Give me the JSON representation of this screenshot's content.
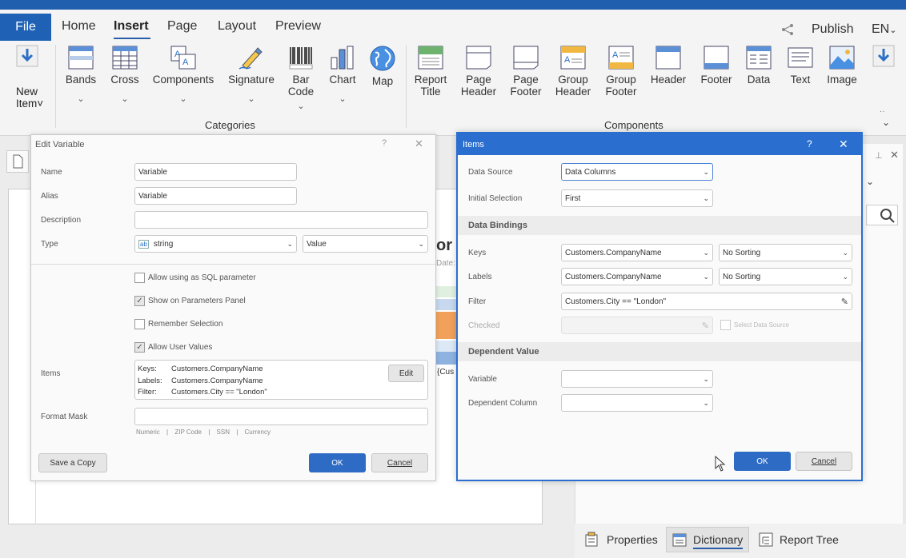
{
  "menu": {
    "file": "File",
    "tabs": [
      "Home",
      "Insert",
      "Page",
      "Layout",
      "Preview"
    ],
    "publish": "Publish",
    "language": "EN"
  },
  "ribbon": {
    "new_item": [
      "New",
      "Item"
    ],
    "categories": [
      {
        "label": "Bands"
      },
      {
        "label": "Cross"
      },
      {
        "label": "Components"
      },
      {
        "label": "Signature"
      },
      {
        "label": "Bar",
        "label2": "Code"
      },
      {
        "label": "Chart"
      },
      {
        "label": "Map"
      }
    ],
    "categories_label": "Categories",
    "components": [
      {
        "label": "Report",
        "label2": "Title"
      },
      {
        "label": "Page",
        "label2": "Header"
      },
      {
        "label": "Page",
        "label2": "Footer"
      },
      {
        "label": "Group",
        "label2": "Header"
      },
      {
        "label": "Group",
        "label2": "Footer"
      },
      {
        "label": "Header"
      },
      {
        "label": "Footer"
      },
      {
        "label": "Data"
      },
      {
        "label": "Text"
      },
      {
        "label": "Image"
      }
    ],
    "components_label": "Components"
  },
  "bg_fragments": {
    "title_frag": "or",
    "date_frag": "Date:",
    "cus_frag": "{Cus"
  },
  "edit_variable": {
    "title": "Edit Variable",
    "name_label": "Name",
    "name_value": "Variable",
    "alias_label": "Alias",
    "alias_value": "Variable",
    "description_label": "Description",
    "description_value": "",
    "type_label": "Type",
    "type_value": "string",
    "type_kind": "Value",
    "checkboxes": [
      {
        "label": "Allow using as SQL parameter",
        "checked": false
      },
      {
        "label": "Show on Parameters Panel",
        "checked": true
      },
      {
        "label": "Remember Selection",
        "checked": false
      },
      {
        "label": "Allow User Values",
        "checked": true
      }
    ],
    "items_label": "Items",
    "items_lines": [
      {
        "key": "Keys:",
        "value": "Customers.CompanyName"
      },
      {
        "key": "Labels:",
        "value": "Customers.CompanyName"
      },
      {
        "key": "Filter:",
        "value": "Customers.City == \"London\""
      }
    ],
    "edit_button": "Edit",
    "format_mask_label": "Format Mask",
    "mask_hints": [
      "Numeric",
      "ZIP Code",
      "SSN",
      "Currency"
    ],
    "save_copy": "Save a Copy",
    "ok": "OK",
    "cancel": "Cancel"
  },
  "items_dialog": {
    "title": "Items",
    "data_source_label": "Data Source",
    "data_source_value": "Data Columns",
    "initial_selection_label": "Initial Selection",
    "initial_selection_value": "First",
    "data_bindings_header": "Data Bindings",
    "keys_label": "Keys",
    "keys_value": "Customers.CompanyName",
    "keys_sort": "No Sorting",
    "labels_label": "Labels",
    "labels_value": "Customers.CompanyName",
    "labels_sort": "No Sorting",
    "filter_label": "Filter",
    "filter_value": "Customers.City == \"London\"",
    "checked_label": "Checked",
    "select_data_source": "Select Data Source",
    "dependent_header": "Dependent Value",
    "variable_label": "Variable",
    "dependent_column_label": "Dependent Column",
    "ok": "OK",
    "cancel": "Cancel"
  },
  "bottom_tabs": [
    "Properties",
    "Dictionary",
    "Report Tree"
  ],
  "colors": {
    "accent": "#1f62b5",
    "ok_button": "#2d6bc4",
    "titlebar": "#2a6fcf"
  }
}
